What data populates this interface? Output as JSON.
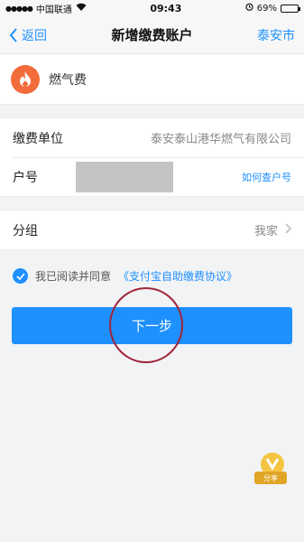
{
  "status_bar": {
    "carrier": "中国联通",
    "time": "09:43",
    "battery_percent": "69%",
    "battery_level": 0.69
  },
  "nav": {
    "back_label": "返回",
    "title": "新增缴费账户",
    "city": "泰安市"
  },
  "service": {
    "name": "燃气费",
    "logo_icon": "flame-icon"
  },
  "form": {
    "unit_label": "缴费单位",
    "unit_value": "泰安泰山港华燃气有限公司",
    "account_label": "户号",
    "account_value": "",
    "query_link": "如何查户号",
    "group_label": "分组",
    "group_value": "我家"
  },
  "agreement": {
    "text": "我已阅读并同意",
    "link": "《支付宝自助缴费协议》"
  },
  "next_button_label": "下一步",
  "badge_label": "分享",
  "colors": {
    "accent": "#1e90ff",
    "logo_bg": "#f26b3a"
  }
}
